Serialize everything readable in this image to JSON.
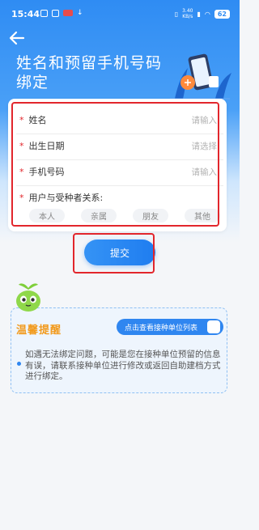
{
  "status": {
    "time": "15:44",
    "battery": "62",
    "netspeed_value": "3.40",
    "netspeed_unit": "KB/s"
  },
  "header": {
    "title": "姓名和预留手机号码绑定"
  },
  "form": {
    "name_label": "姓名",
    "name_placeholder": "请输入",
    "birth_label": "出生日期",
    "birth_placeholder": "请选择",
    "phone_label": "手机号码",
    "phone_placeholder": "请输入",
    "relation_label": "用户与受种者关系:",
    "relations": [
      "本人",
      "亲属",
      "朋友",
      "其他"
    ],
    "required_mark": "*"
  },
  "submit_label": "提交",
  "tips": {
    "title": "温馨提醒",
    "button_label": "点击查看接种单位列表",
    "text": "如遇无法绑定问题，可能是您在接种单位预留的信息有误，请联系接种单位进行修改或返回自助建档方式进行绑定。"
  },
  "colors": {
    "primary": "#2f86f0",
    "highlight": "#e2262c",
    "tips_title": "#f29a1c"
  }
}
